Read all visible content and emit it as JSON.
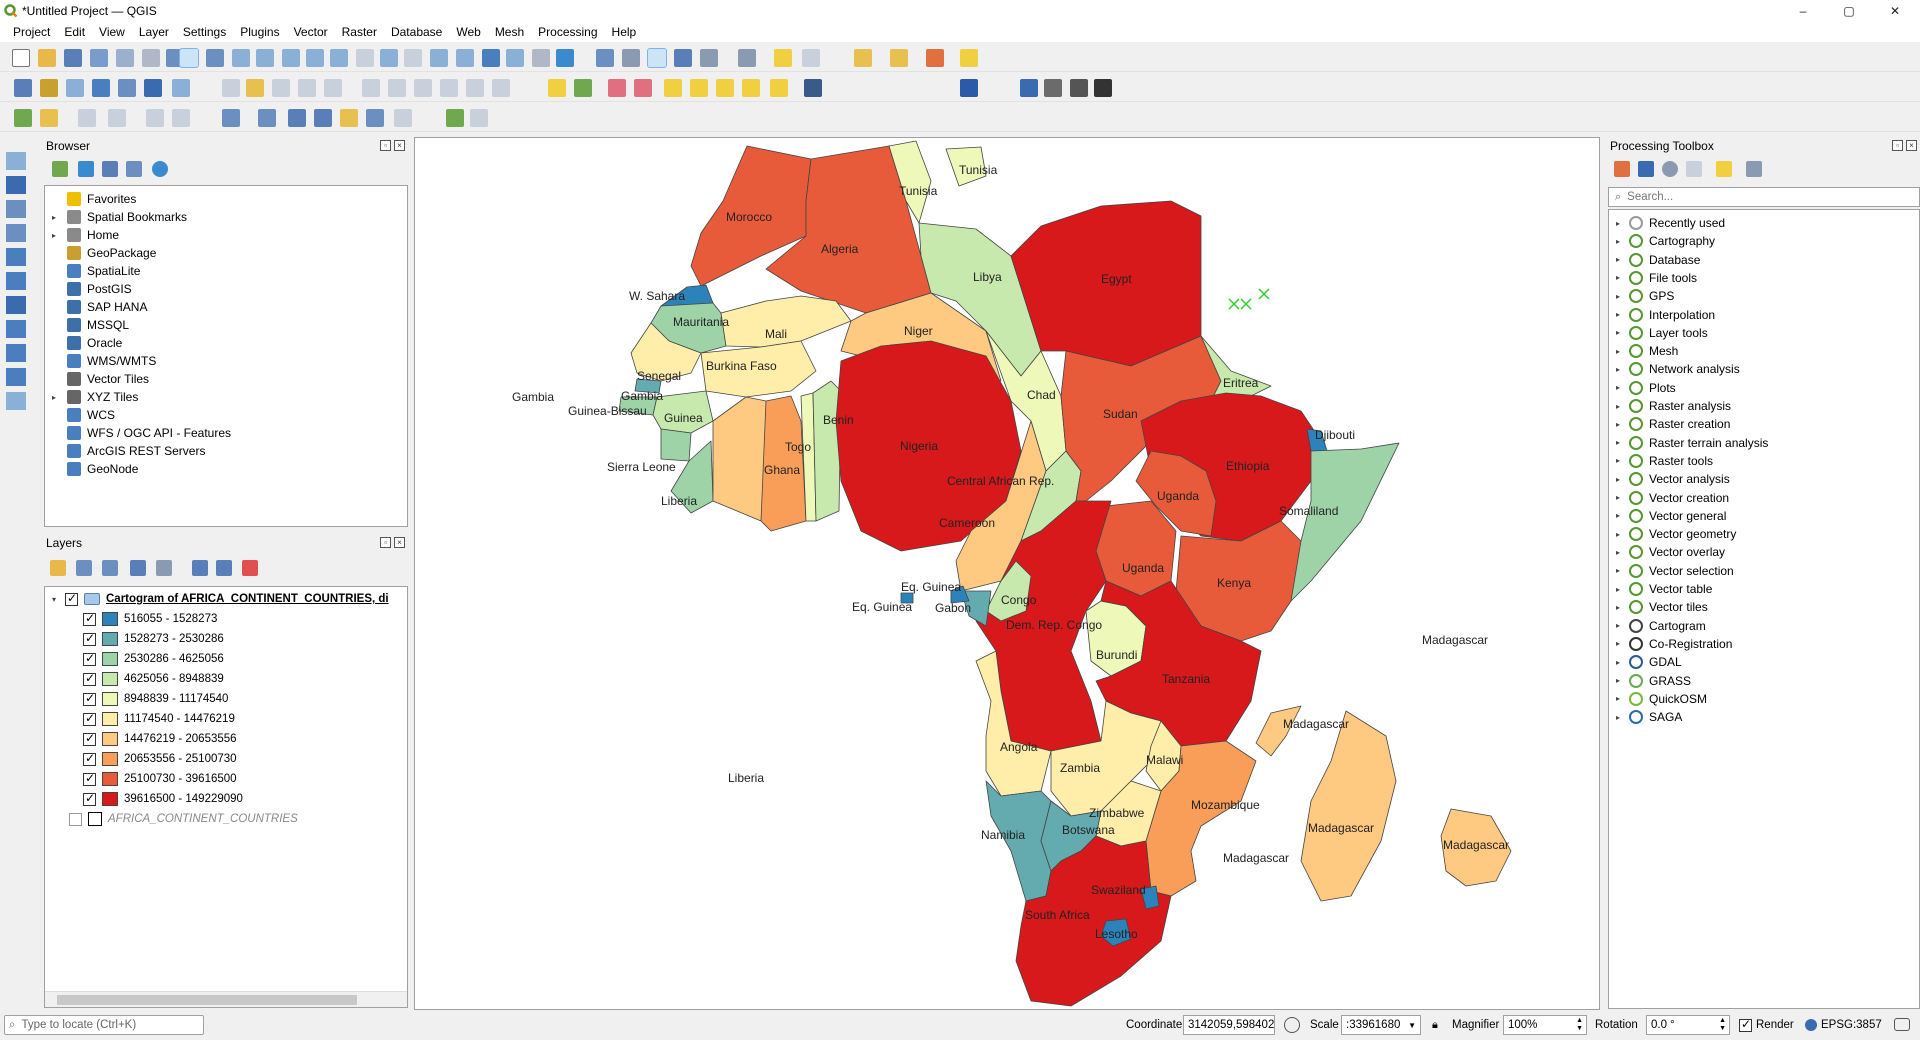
{
  "window": {
    "title": "*Untitled Project — QGIS",
    "controls": [
      "–",
      "▢",
      "✕"
    ]
  },
  "menu": [
    "Project",
    "Edit",
    "View",
    "Layer",
    "Settings",
    "Plugins",
    "Vector",
    "Raster",
    "Database",
    "Web",
    "Mesh",
    "Processing",
    "Help"
  ],
  "browser": {
    "title": "Browser",
    "items": [
      {
        "label": "Favorites",
        "icon": "star-icon",
        "color": "#f0c000",
        "expand": ""
      },
      {
        "label": "Spatial Bookmarks",
        "icon": "bookmark-icon",
        "color": "#8a8a8a",
        "expand": "▸"
      },
      {
        "label": "Home",
        "icon": "home-icon",
        "color": "#8a8a8a",
        "expand": "▸"
      },
      {
        "label": "GeoPackage",
        "icon": "geopackage-icon",
        "color": "#c8a030",
        "expand": ""
      },
      {
        "label": "SpatiaLite",
        "icon": "spatialite-icon",
        "color": "#4a7fbf",
        "expand": ""
      },
      {
        "label": "PostGIS",
        "icon": "postgis-icon",
        "color": "#3d6fa8",
        "expand": ""
      },
      {
        "label": "SAP HANA",
        "icon": "sap-hana-icon",
        "color": "#3d6fa8",
        "expand": ""
      },
      {
        "label": "MSSQL",
        "icon": "mssql-icon",
        "color": "#3d6fa8",
        "expand": ""
      },
      {
        "label": "Oracle",
        "icon": "oracle-icon",
        "color": "#3d6fa8",
        "expand": ""
      },
      {
        "label": "WMS/WMTS",
        "icon": "wms-icon",
        "color": "#4a7fbf",
        "expand": ""
      },
      {
        "label": "Vector Tiles",
        "icon": "vector-tiles-icon",
        "color": "#666666",
        "expand": ""
      },
      {
        "label": "XYZ Tiles",
        "icon": "xyz-tiles-icon",
        "color": "#666666",
        "expand": "▸"
      },
      {
        "label": "WCS",
        "icon": "wcs-icon",
        "color": "#4a7fbf",
        "expand": ""
      },
      {
        "label": "WFS / OGC API - Features",
        "icon": "wfs-icon",
        "color": "#4a7fbf",
        "expand": ""
      },
      {
        "label": "ArcGIS REST Servers",
        "icon": "arcgis-icon",
        "color": "#4a7fbf",
        "expand": ""
      },
      {
        "label": "GeoNode",
        "icon": "geonode-icon",
        "color": "#4a7fbf",
        "expand": ""
      }
    ]
  },
  "layers": {
    "title": "Layers",
    "main_layer": "Cartogram of AFRICA_CONTINENT_COUNTRIES, di",
    "classes": [
      {
        "label": "516055 - 1528273",
        "color": "#2b83ba"
      },
      {
        "label": "1528273 - 2530286",
        "color": "#64abb0"
      },
      {
        "label": "2530286 - 4625056",
        "color": "#9dd3a7"
      },
      {
        "label": "4625056 - 8948839",
        "color": "#c7e9ad"
      },
      {
        "label": "8948839 - 11174540",
        "color": "#edf8b9"
      },
      {
        "label": "11174540 - 14476219",
        "color": "#ffedaa"
      },
      {
        "label": "14476219 - 20653556",
        "color": "#fec980"
      },
      {
        "label": "20653556 - 25100730",
        "color": "#f99e59"
      },
      {
        "label": "25100730 - 39616500",
        "color": "#e85b3a"
      },
      {
        "label": "39616500 - 149229090",
        "color": "#d7191c"
      }
    ],
    "second_layer": "AFRICA_CONTINENT_COUNTRIES"
  },
  "toolbox": {
    "title": "Processing Toolbox",
    "search_placeholder": "Search...",
    "items": [
      {
        "label": "Recently used",
        "icon": "clock-icon"
      },
      {
        "label": "Cartography",
        "icon": "qgis-icon"
      },
      {
        "label": "Database",
        "icon": "qgis-icon"
      },
      {
        "label": "File tools",
        "icon": "qgis-icon"
      },
      {
        "label": "GPS",
        "icon": "qgis-icon"
      },
      {
        "label": "Interpolation",
        "icon": "qgis-icon"
      },
      {
        "label": "Layer tools",
        "icon": "qgis-icon"
      },
      {
        "label": "Mesh",
        "icon": "qgis-icon"
      },
      {
        "label": "Network analysis",
        "icon": "qgis-icon"
      },
      {
        "label": "Plots",
        "icon": "qgis-icon"
      },
      {
        "label": "Raster analysis",
        "icon": "qgis-icon"
      },
      {
        "label": "Raster creation",
        "icon": "qgis-icon"
      },
      {
        "label": "Raster terrain analysis",
        "icon": "qgis-icon"
      },
      {
        "label": "Raster tools",
        "icon": "qgis-icon"
      },
      {
        "label": "Vector analysis",
        "icon": "qgis-icon"
      },
      {
        "label": "Vector creation",
        "icon": "qgis-icon"
      },
      {
        "label": "Vector general",
        "icon": "qgis-icon"
      },
      {
        "label": "Vector geometry",
        "icon": "qgis-icon"
      },
      {
        "label": "Vector overlay",
        "icon": "qgis-icon"
      },
      {
        "label": "Vector selection",
        "icon": "qgis-icon"
      },
      {
        "label": "Vector table",
        "icon": "qgis-icon"
      },
      {
        "label": "Vector tiles",
        "icon": "qgis-icon"
      },
      {
        "label": "Cartogram",
        "icon": "cartogram-icon"
      },
      {
        "label": "Co-Registration",
        "icon": "coregistration-icon"
      },
      {
        "label": "GDAL",
        "icon": "gdal-icon"
      },
      {
        "label": "GRASS",
        "icon": "grass-icon"
      },
      {
        "label": "QuickOSM",
        "icon": "quickosm-icon"
      },
      {
        "label": "SAGA",
        "icon": "saga-icon"
      }
    ]
  },
  "map_labels": {
    "tunisia_1": "Tunisia",
    "tunisia_2": "Tunisia",
    "morocco": "Morocco",
    "algeria": "Algeria",
    "libya": "Libya",
    "egypt": "Egypt",
    "w_sahara": "W. Sahara",
    "mauritania": "Mauritania",
    "mali": "Mali",
    "niger": "Niger",
    "senegal": "Senegal",
    "burkina_faso": "Burkina Faso",
    "gambia_1": "Gambia",
    "gambia_2": "Gambia",
    "guinea_bissau": "Guinea-Bissau",
    "guinea": "Guinea",
    "sierra_leone": "Sierra Leone",
    "liberia_1": "Liberia",
    "liberia_2": "Liberia",
    "ghana": "Ghana",
    "togo": "Togo",
    "benin": "Benin",
    "nigeria": "Nigeria",
    "chad": "Chad",
    "sudan": "Sudan",
    "eritrea": "Eritrea",
    "djibouti": "Djibouti",
    "ethiopia": "Ethiopia",
    "somaliland": "Somaliland",
    "uganda_1": "Uganda",
    "uganda_2": "Uganda",
    "central_african_rep": "Central African Rep.",
    "cameroon": "Cameroon",
    "kenya": "Kenya",
    "eq_guinea_1": "Eq. Guinea",
    "eq_guinea_2": "Eq. Guinea",
    "gabon": "Gabon",
    "congo": "Congo",
    "dem_rep_congo": "Dem. Rep. Congo",
    "burundi": "Burundi",
    "tanzania": "Tanzania",
    "angola": "Angola",
    "zambia": "Zambia",
    "malawi": "Malawi",
    "mozambique": "Mozambique",
    "zimbabwe": "Zimbabwe",
    "namibia": "Namibia",
    "botswana": "Botswana",
    "swaziland": "Swaziland",
    "south_africa": "South Africa",
    "lesotho": "Lesotho",
    "madagascar_1": "Madagascar",
    "madagascar_2": "Madagascar",
    "madagascar_3": "Madagascar",
    "madagascar_4": "Madagascar",
    "madagascar_5": "Madagascar"
  },
  "status": {
    "locate_placeholder": "Type to locate (Ctrl+K)",
    "coordinate_label": "Coordinate",
    "coordinate": "3142059,598402",
    "scale_label": "Scale",
    "scale": ":33961680",
    "magnifier_label": "Magnifier",
    "magnifier": "100%",
    "rotation_label": "Rotation",
    "rotation": "0.0 °",
    "render_label": "Render",
    "crs": "EPSG:3857"
  }
}
